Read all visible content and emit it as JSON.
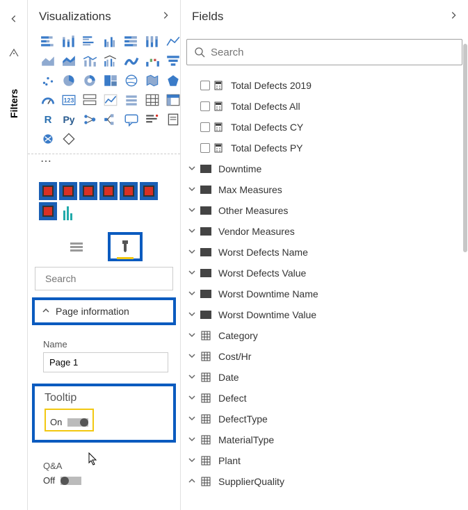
{
  "rail": {
    "filters_label": "Filters"
  },
  "viz_panel": {
    "title": "Visualizations",
    "search_placeholder": "Search",
    "sections": {
      "page_info": {
        "label": "Page information",
        "name_label": "Name",
        "name_value": "Page 1"
      },
      "tooltip": {
        "label": "Tooltip",
        "state_label": "On",
        "state": true
      },
      "qa": {
        "label": "Q&A",
        "state_label": "Off",
        "state": false
      }
    }
  },
  "fields_panel": {
    "title": "Fields",
    "search_placeholder": "Search",
    "measures": [
      "Total Defects 2019",
      "Total Defects All",
      "Total Defects CY",
      "Total Defects PY"
    ],
    "folders": [
      "Downtime",
      "Max Measures",
      "Other Measures",
      "Vendor Measures",
      "Worst Defects Name",
      "Worst Defects Value",
      "Worst Downtime Name",
      "Worst Downtime Value"
    ],
    "tables": [
      "Category",
      "Cost/Hr",
      "Date",
      "Defect",
      "DefectType",
      "MaterialType",
      "Plant",
      "SupplierQuality"
    ]
  },
  "colors": {
    "highlight_blue": "#0b5bbf",
    "highlight_yellow": "#f2c811"
  }
}
